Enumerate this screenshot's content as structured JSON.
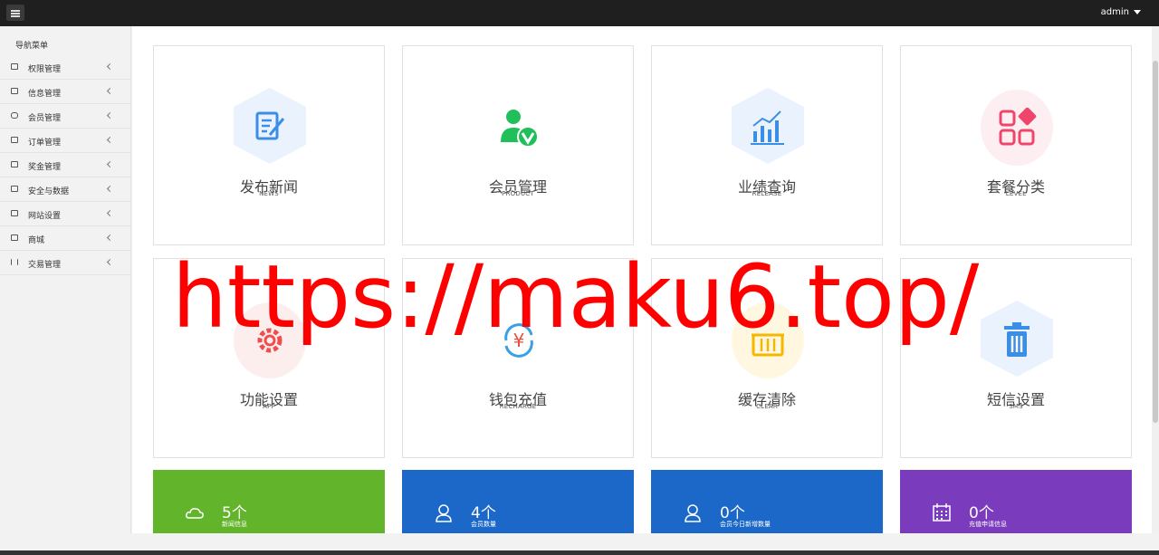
{
  "topbar": {
    "user": "admin"
  },
  "sidebar": {
    "title": "导航菜单",
    "items": [
      {
        "label": "权限管理",
        "icon": "users-icon"
      },
      {
        "label": "信息管理",
        "icon": "users-icon"
      },
      {
        "label": "会员管理",
        "icon": "card-icon"
      },
      {
        "label": "订单管理",
        "icon": "shirt-icon"
      },
      {
        "label": "奖金管理",
        "icon": "monitor-icon"
      },
      {
        "label": "安全与数据",
        "icon": "monitor-icon"
      },
      {
        "label": "网站设置",
        "icon": "monitor-icon"
      },
      {
        "label": "商城",
        "icon": "store-icon"
      },
      {
        "label": "交易管理",
        "icon": "sliders-icon"
      }
    ]
  },
  "tiles": [
    {
      "title": "发布新闻",
      "sub": "NEWS",
      "icon": "edit-document-icon",
      "color": "#3a8ee6",
      "bg": "#eaf3fd"
    },
    {
      "title": "会员管理",
      "sub": "PRODUCT",
      "icon": "verified-user-icon",
      "color": "#1fbf5a",
      "bg": "#ffffff"
    },
    {
      "title": "业绩查询",
      "sub": "RELEASE",
      "icon": "bar-chart-icon",
      "color": "#3a8ee6",
      "bg": "#eaf3fd"
    },
    {
      "title": "套餐分类",
      "sub": "LEVEL",
      "icon": "categories-icon",
      "color": "#f0456a",
      "bg": "#fdeef2"
    },
    {
      "title": "功能设置",
      "sub": "APP",
      "icon": "gear-icon",
      "color": "#f04e4e",
      "bg": "#fdeeee"
    },
    {
      "title": "钱包充值",
      "sub": "RECHARGE",
      "icon": "yen-refresh-icon",
      "color": "#e94e3c",
      "bg": "#ffffff"
    },
    {
      "title": "缓存清除",
      "sub": "CLEAR",
      "icon": "basket-icon",
      "color": "#f5b800",
      "bg": "#fff7e0"
    },
    {
      "title": "短信设置",
      "sub": "SMS",
      "icon": "trash-icon",
      "color": "#3a8ee6",
      "bg": "#eaf3fd"
    }
  ],
  "stats": [
    {
      "num": "5个",
      "label": "新闻信息",
      "icon": "cloud-icon",
      "color": "#62b42b"
    },
    {
      "num": "4个",
      "label": "会员数量",
      "icon": "user-icon",
      "color": "#1b68c9"
    },
    {
      "num": "0个",
      "label": "会员今日新增数量",
      "icon": "user-icon",
      "color": "#1b68c9"
    },
    {
      "num": "0个",
      "label": "充值申请信息",
      "icon": "calendar-icon",
      "color": "#7b3bbd"
    }
  ],
  "watermark": "https://maku6.top/"
}
